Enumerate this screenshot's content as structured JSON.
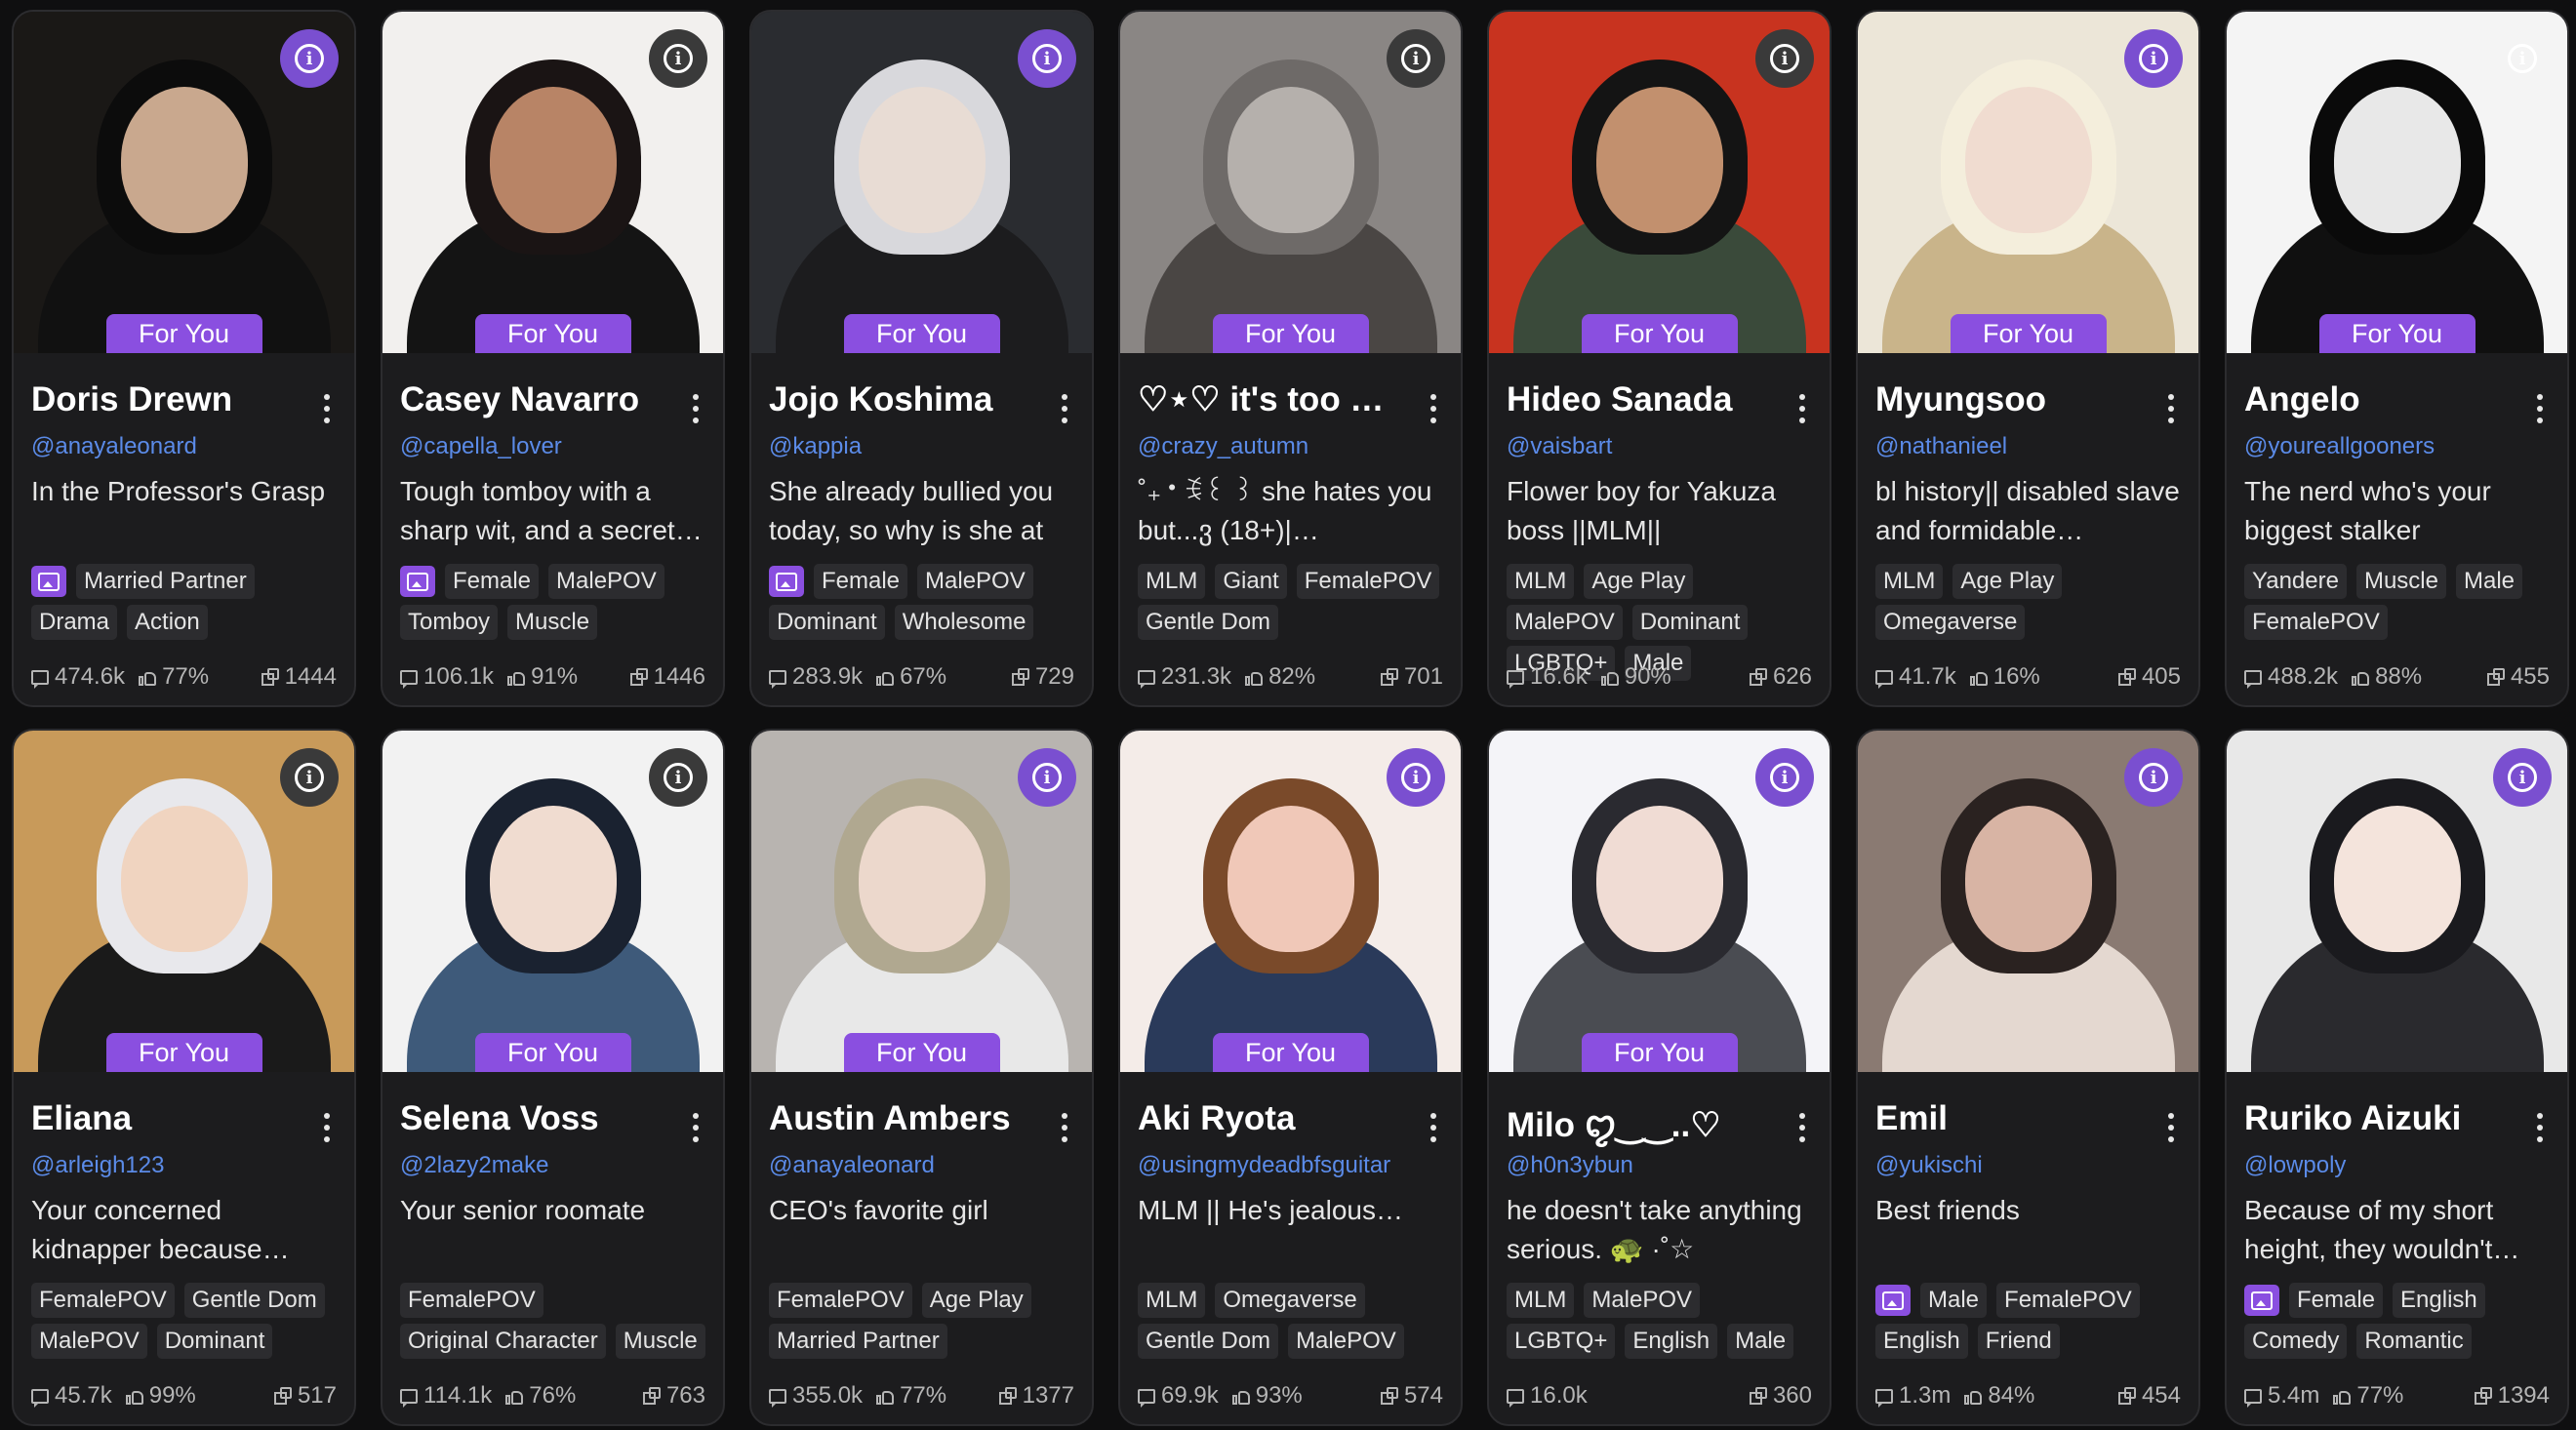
{
  "badge_label": "For You",
  "accent_color": "#8a4fe0",
  "handle_color": "#5b8be8",
  "cards": [
    {
      "name": "Doris Drewn",
      "handle": "@anayaleonard",
      "desc": "In the Professor's Grasp",
      "tags": [
        "Married Partner",
        "Drama",
        "Action"
      ],
      "has_image_tag": true,
      "chats": "474.6k",
      "likes": "77%",
      "count": "1444",
      "for_you": true,
      "info_style": "purple",
      "art": {
        "bg": "#1a1816",
        "hair": "#0c0c0c",
        "skin": "#c9a88e",
        "body": "#111"
      }
    },
    {
      "name": "Casey Navarro",
      "handle": "@capella_lover",
      "desc": "Tough tomboy with a sharp wit, and a secret…",
      "tags": [
        "Female",
        "MalePOV",
        "Tomboy",
        "Muscle"
      ],
      "has_image_tag": true,
      "chats": "106.1k",
      "likes": "91%",
      "count": "1446",
      "for_you": true,
      "info_style": "dark",
      "art": {
        "bg": "#f2f0ee",
        "hair": "#1a1414",
        "skin": "#b88466",
        "body": "#141414"
      }
    },
    {
      "name": "Jojo Koshima",
      "handle": "@kappia",
      "desc": "She already bullied you today, so why is she at",
      "tags": [
        "Female",
        "MalePOV",
        "Dominant",
        "Wholesome"
      ],
      "has_image_tag": true,
      "chats": "283.9k",
      "likes": "67%",
      "count": "729",
      "for_you": true,
      "info_style": "purple",
      "art": {
        "bg": "#2a2c30",
        "hair": "#d8d8dc",
        "skin": "#e8dcd4",
        "body": "#1c1c1e"
      }
    },
    {
      "name": "♡⋆♡ it's too b…",
      "handle": "@crazy_autumn",
      "desc": "˚₊‧ꉂ꒰ ꒱ she hates you but...ვ (18+)|…",
      "tags": [
        "MLM",
        "Giant",
        "FemalePOV",
        "Gentle Dom"
      ],
      "has_image_tag": false,
      "chats": "231.3k",
      "likes": "82%",
      "count": "701",
      "for_you": true,
      "info_style": "dark",
      "art": {
        "bg": "#8a8684",
        "hair": "#6e6a68",
        "skin": "#b5b0ac",
        "body": "#4a4644"
      }
    },
    {
      "name": "Hideo Sanada",
      "handle": "@vaisbart",
      "desc": "Flower boy for Yakuza boss ||MLM||",
      "tags": [
        "MLM",
        "Age Play",
        "MalePOV",
        "Dominant",
        "LGBTQ+",
        "Male"
      ],
      "has_image_tag": false,
      "chats": "16.6k",
      "likes": "90%",
      "count": "626",
      "for_you": true,
      "info_style": "dark",
      "art": {
        "bg": "#c8331f",
        "hair": "#141414",
        "skin": "#c2906e",
        "body": "#3a4a3a"
      }
    },
    {
      "name": "Myungsoo",
      "handle": "@nathanieel",
      "desc": "bl history|| disabled slave and formidable…",
      "tags": [
        "MLM",
        "Age Play",
        "Omegaverse"
      ],
      "has_image_tag": false,
      "chats": "41.7k",
      "likes": "16%",
      "count": "405",
      "for_you": true,
      "info_style": "purple",
      "art": {
        "bg": "#ece6d8",
        "hair": "#f4eedc",
        "skin": "#f0dcd0",
        "body": "#c9b48a"
      }
    },
    {
      "name": "Angelo",
      "handle": "@youreallgooners",
      "desc": "The nerd who's your biggest stalker",
      "tags": [
        "Yandere",
        "Muscle",
        "Male",
        "FemalePOV"
      ],
      "has_image_tag": false,
      "chats": "488.2k",
      "likes": "88%",
      "count": "455",
      "for_you": true,
      "info_style": "none",
      "art": {
        "bg": "#f4f4f4",
        "hair": "#0a0a0a",
        "skin": "#e8e8e8",
        "body": "#101010"
      }
    },
    {
      "name": "Eliana",
      "handle": "@arleigh123",
      "desc": "Your concerned kidnapper because you…",
      "tags": [
        "FemalePOV",
        "Gentle Dom",
        "MalePOV",
        "Dominant"
      ],
      "has_image_tag": false,
      "chats": "45.7k",
      "likes": "99%",
      "count": "517",
      "for_you": true,
      "info_style": "dark",
      "art": {
        "bg": "#c89a5a",
        "hair": "#e8e8ec",
        "skin": "#f0d4c0",
        "body": "#1a1a1a"
      }
    },
    {
      "name": "Selena Voss",
      "handle": "@2lazy2make",
      "desc": "Your senior roomate",
      "tags": [
        "FemalePOV",
        "Original Character",
        "Muscle"
      ],
      "has_image_tag": false,
      "chats": "114.1k",
      "likes": "76%",
      "count": "763",
      "for_you": true,
      "info_style": "dark",
      "art": {
        "bg": "#f2f2f2",
        "hair": "#1a2230",
        "skin": "#f0dcd0",
        "body": "#3e5a7a"
      }
    },
    {
      "name": "Austin Ambers",
      "handle": "@anayaleonard",
      "desc": "CEO's favorite girl",
      "tags": [
        "FemalePOV",
        "Age Play",
        "Married Partner"
      ],
      "has_image_tag": false,
      "chats": "355.0k",
      "likes": "77%",
      "count": "1377",
      "for_you": true,
      "info_style": "purple",
      "art": {
        "bg": "#b8b4b0",
        "hair": "#b0a890",
        "skin": "#ecd8cc",
        "body": "#e8e8e8"
      }
    },
    {
      "name": "Aki Ryota",
      "handle": "@usingmydeadbfsguitar",
      "desc": "MLM || He's jealous…",
      "tags": [
        "MLM",
        "Omegaverse",
        "Gentle Dom",
        "MalePOV"
      ],
      "has_image_tag": false,
      "chats": "69.9k",
      "likes": "93%",
      "count": "574",
      "for_you": true,
      "info_style": "purple",
      "art": {
        "bg": "#f4ece8",
        "hair": "#7a4a2a",
        "skin": "#f0c8b8",
        "body": "#2a3a5a"
      }
    },
    {
      "name": "Milo ꨄ︎‿‿..♡",
      "handle": "@h0n3ybun",
      "desc": "he doesn't take anything serious. 🐢 ·˚☆",
      "tags": [
        "MLM",
        "MalePOV",
        "LGBTQ+",
        "English",
        "Male"
      ],
      "has_image_tag": false,
      "chats": "16.0k",
      "likes": "",
      "count": "360",
      "for_you": true,
      "info_style": "purple",
      "art": {
        "bg": "#f4f4f8",
        "hair": "#2a2a30",
        "skin": "#f0dcd4",
        "body": "#4a4c52"
      }
    },
    {
      "name": "Emil",
      "handle": "@yukischi",
      "desc": "Best friends",
      "tags": [
        "Male",
        "FemalePOV",
        "English",
        "Friend"
      ],
      "has_image_tag": true,
      "chats": "1.3m",
      "likes": "84%",
      "count": "454",
      "for_you": false,
      "info_style": "purple",
      "art": {
        "bg": "#8a7a72",
        "hair": "#2a2220",
        "skin": "#d8b4a4",
        "body": "#e4d8d0"
      }
    },
    {
      "name": "Ruriko Aizuki",
      "handle": "@lowpoly",
      "desc": "Because of my short height, they wouldn't sel…",
      "tags": [
        "Female",
        "English",
        "Comedy",
        "Romantic"
      ],
      "has_image_tag": true,
      "chats": "5.4m",
      "likes": "77%",
      "count": "1394",
      "for_you": false,
      "info_style": "purple",
      "art": {
        "bg": "#e8e8e8",
        "hair": "#1a1a1e",
        "skin": "#f4e4dc",
        "body": "#2a2a2e"
      }
    }
  ]
}
